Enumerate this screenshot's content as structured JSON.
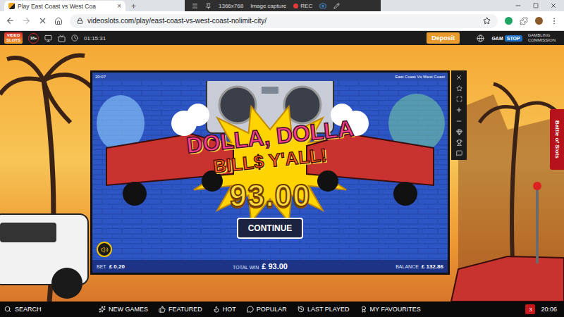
{
  "browser": {
    "tabs": [
      {
        "title": "Play East Coast vs West Coa",
        "close": "×",
        "selected": true
      }
    ],
    "new_tab": "+",
    "capture_bar": {
      "size": "1366x768",
      "mode": "Image capture",
      "record": "REC"
    },
    "url": "videoslots.com/play/east-coast-vs-west-coast-nolimit-city/"
  },
  "site_header": {
    "logo_top": "VIDEO",
    "logo_bottom": "SLOTS",
    "age_limit": "18+",
    "session_time": "01:15:31",
    "deposit": "Deposit",
    "gamstop_a": "GAM",
    "gamstop_b": "STOP",
    "commission_line1": "GAMBLING",
    "commission_line2": "COMMISSION"
  },
  "game": {
    "clock": "20:07",
    "title": "East Coast Vs West Coast",
    "banner_top": "DOLLA, DOLLA",
    "banner_bottom": "BILL$ Y'ALL!",
    "win_amount": "93.00",
    "continue": "CONTINUE",
    "sound_on": true,
    "bet_label": "BET",
    "bet": "£ 0.20",
    "total_win_label": "TOTAL WIN",
    "total_win": "£ 93.00",
    "balance_label": "BALANCE",
    "balance": "£ 132.86"
  },
  "side_tab": "Battle of Slots",
  "bottom_bar": {
    "search": "SEARCH",
    "items": [
      "NEW GAMES",
      "FEATURED",
      "HOT",
      "POPULAR",
      "LAST PLAYED",
      "MY FAVOURITES"
    ],
    "notifications": "3",
    "time": "20:06"
  }
}
